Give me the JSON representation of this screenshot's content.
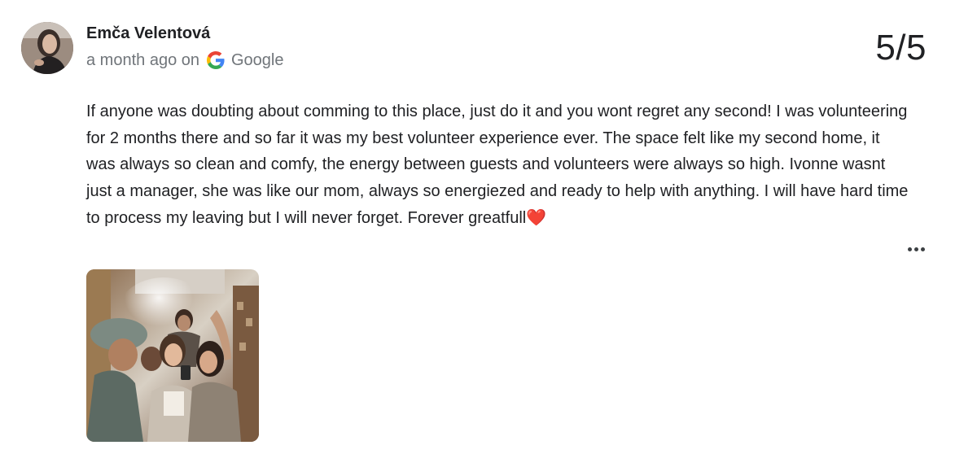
{
  "review": {
    "reviewer_name": "Emča Velentová",
    "time_ago": "a month ago on",
    "source": "Google",
    "rating": "5/5",
    "text": "If anyone was doubting about comming to this place, just do it and you wont regret any second! I was volunteering for 2 months there and so far it was my best volunteer experience ever. The space felt like my second home, it was always so clean and comfy, the energy between guests and volunteers were always so high. Ivonne wasnt just a manager, she was like our mom, always so energiezed and ready to help with anything. I will have hard time to process my leaving but I will never forget. Forever greatfull",
    "text_emoji": "❤️",
    "icons": {
      "source_logo": "google-g-icon",
      "more": "more-options-icon"
    },
    "photo_count": 1
  },
  "colors": {
    "text_primary": "#202124",
    "text_secondary": "#70757a",
    "heart": "#e53935",
    "google_blue": "#4285F4",
    "google_red": "#EA4335",
    "google_yellow": "#FBBC05",
    "google_green": "#34A853"
  }
}
